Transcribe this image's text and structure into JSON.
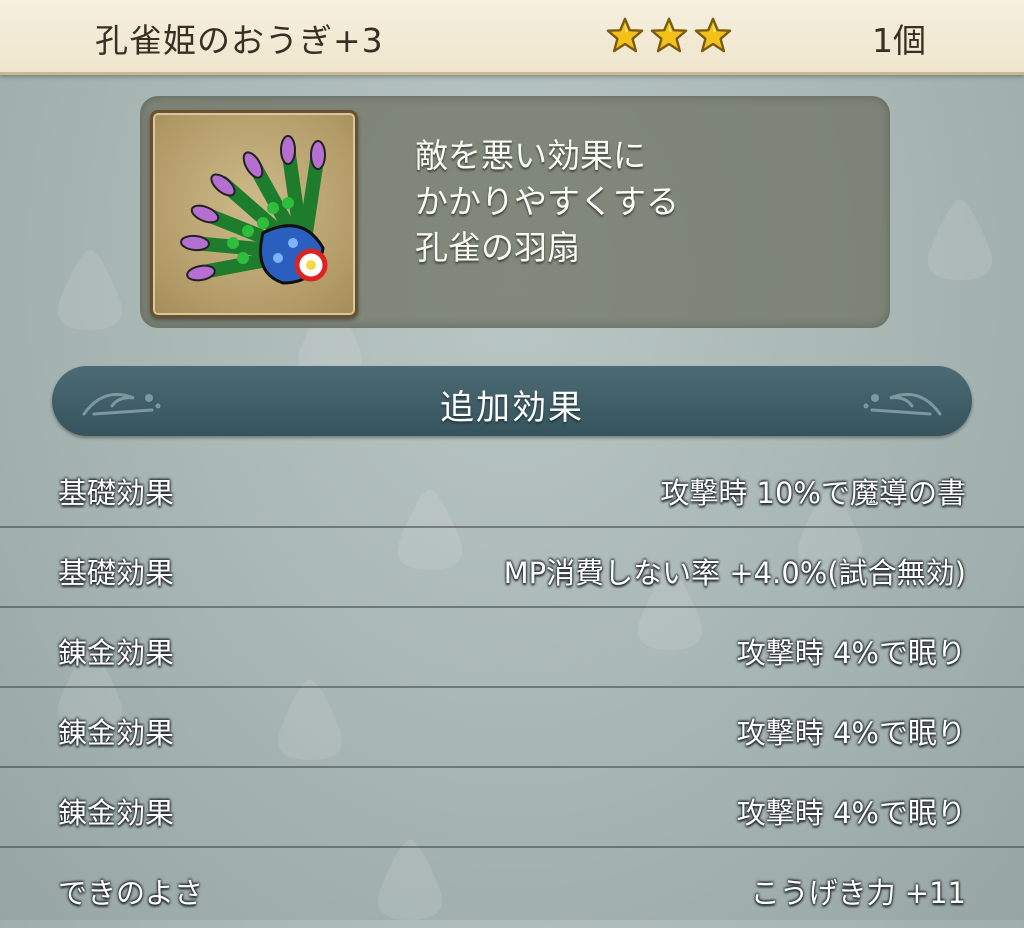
{
  "header": {
    "item_name": "孔雀姫のおうぎ+3",
    "stars": 3,
    "count": "1個"
  },
  "item": {
    "icon": "peacock-fan-icon",
    "description_lines": [
      "敵を悪い効果に",
      "かかりやすくする",
      "孔雀の羽扇"
    ]
  },
  "section": {
    "title": "追加効果"
  },
  "effects": [
    {
      "label": "基礎効果",
      "value": "攻撃時  10%で魔導の書"
    },
    {
      "label": "基礎効果",
      "value": "MP消費しない率  +4.0%(試合無効)"
    },
    {
      "label": "錬金効果",
      "value": "攻撃時  4%で眠り"
    },
    {
      "label": "錬金効果",
      "value": "攻撃時  4%で眠り"
    },
    {
      "label": "錬金効果",
      "value": "攻撃時  4%で眠り"
    },
    {
      "label": "できのよさ",
      "value": "こうげき力  +11"
    }
  ],
  "colors": {
    "star": "#f2c21b",
    "banner": "#3e5d66",
    "header_bg": "#f3ead3"
  }
}
